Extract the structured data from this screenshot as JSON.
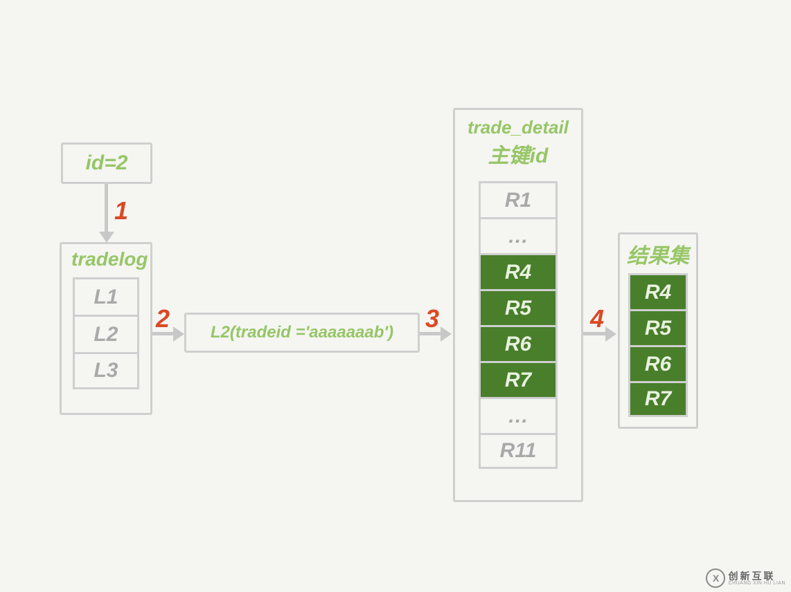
{
  "id_box": {
    "label": "id=2"
  },
  "tradelog": {
    "title": "tradelog",
    "rows": [
      "L1",
      "L2",
      "L3"
    ]
  },
  "lookup": {
    "text": "L2(tradeid ='aaaaaaab')"
  },
  "trade_detail": {
    "title_line1": "trade_detail",
    "title_line2": "主键id",
    "rows": [
      "R1",
      "…",
      "R4",
      "R5",
      "R6",
      "R7",
      "…",
      "R11"
    ],
    "highlight": [
      false,
      false,
      true,
      true,
      true,
      true,
      false,
      false
    ]
  },
  "result": {
    "title": "结果集",
    "rows": [
      "R4",
      "R5",
      "R6",
      "R7"
    ]
  },
  "steps": {
    "s1": "1",
    "s2": "2",
    "s3": "3",
    "s4": "4"
  },
  "watermark": {
    "cn": "创新互联",
    "en": "CHUANG XIN HU LIAN",
    "icon": "X"
  }
}
